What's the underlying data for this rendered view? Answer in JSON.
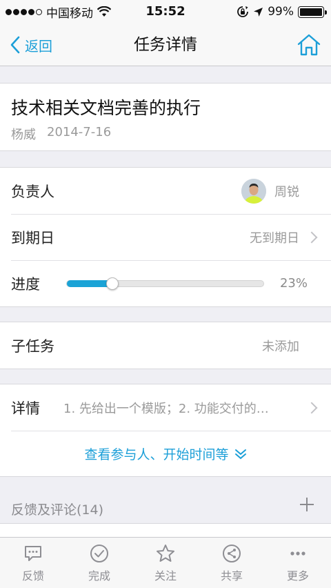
{
  "status_bar": {
    "carrier": "中国移动",
    "time": "15:52",
    "battery": "99%"
  },
  "nav": {
    "back_label": "返回",
    "title": "任务详情"
  },
  "task": {
    "title": "技术相关文档完善的执行",
    "author": "杨威",
    "date": "2014-7-16"
  },
  "fields": {
    "owner_label": "负责人",
    "owner_name": "周锐",
    "due_label": "到期日",
    "due_value": "无到期日",
    "progress_label": "进度",
    "progress_value": "23%",
    "progress_fraction": 0.23
  },
  "subtasks": {
    "label": "子任务",
    "value": "未添加"
  },
  "details": {
    "label": "详情",
    "text": "1. 先给出一个模版；2. 功能交付的…",
    "more_link": "查看参与人、开始时间等"
  },
  "feedback": {
    "header": "反馈及评论(14)"
  },
  "tabbar": {
    "items": [
      {
        "label": "反馈",
        "icon": "chat-bubble-icon"
      },
      {
        "label": "完成",
        "icon": "check-circle-icon"
      },
      {
        "label": "关注",
        "icon": "star-icon"
      },
      {
        "label": "共享",
        "icon": "share-icon"
      },
      {
        "label": "更多",
        "icon": "more-dots-icon"
      }
    ]
  },
  "colors": {
    "accent": "#1c9fd8",
    "progress": "#1aa3d6",
    "background": "#efeff4"
  }
}
